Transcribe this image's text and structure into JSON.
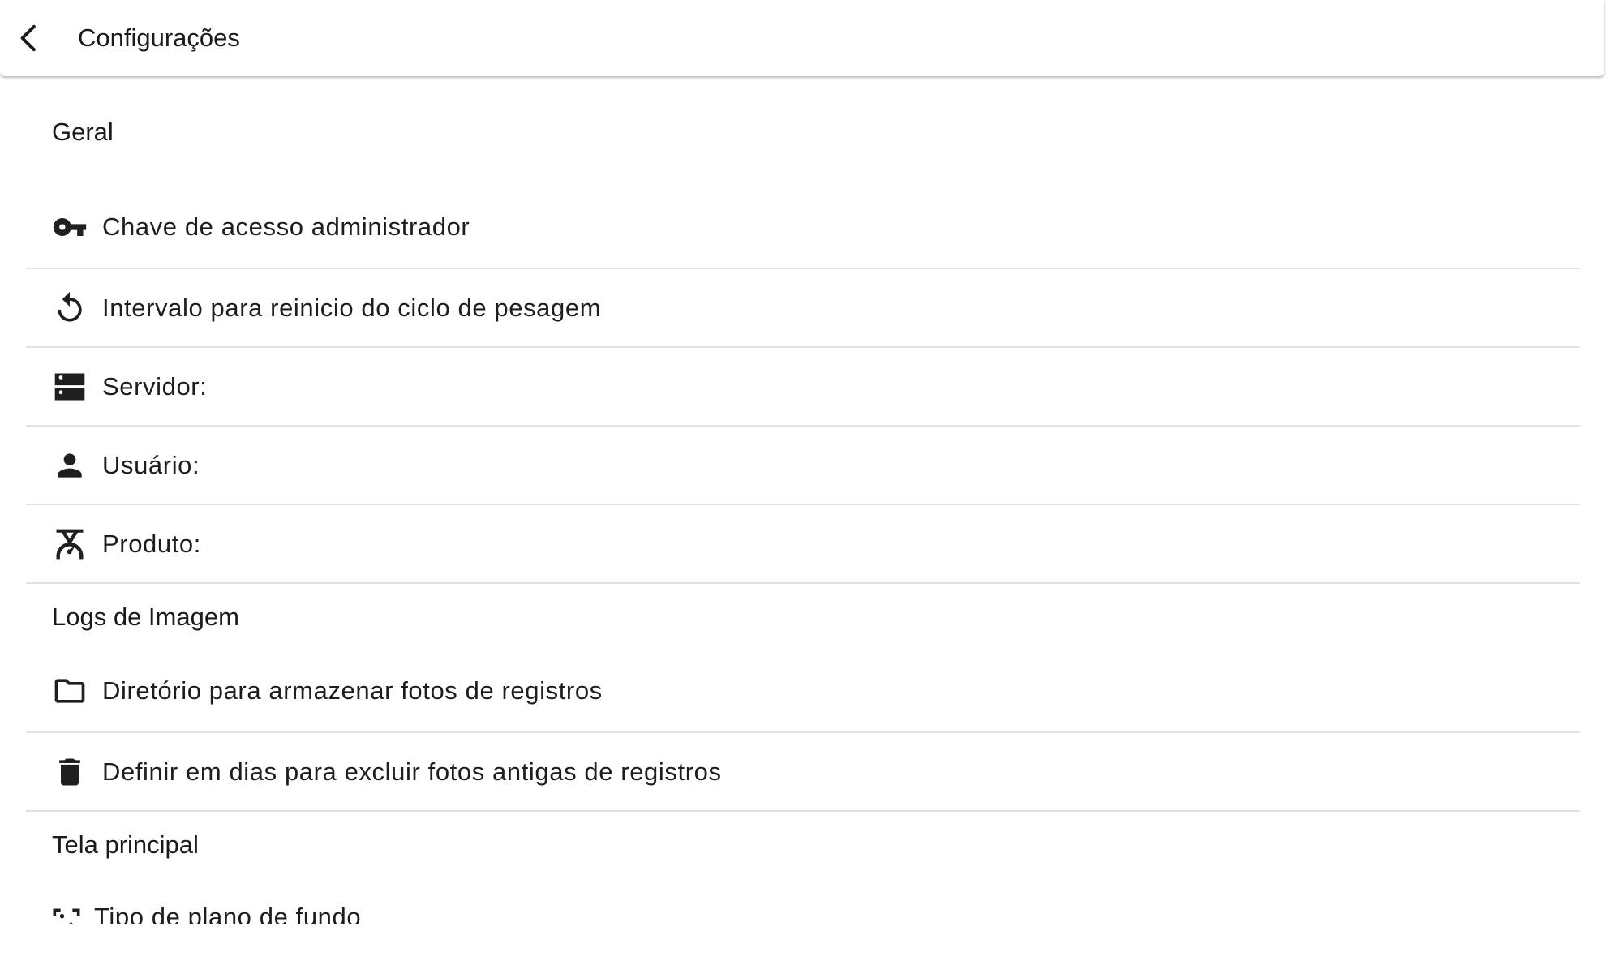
{
  "appbar": {
    "title": "Configurações",
    "back_icon": "arrow-back-icon"
  },
  "sections": [
    {
      "header": "Geral",
      "items": [
        {
          "icon": "key-icon",
          "label": "Chave de acesso administrador"
        },
        {
          "icon": "restart-icon",
          "label": "Intervalo para reinicio do ciclo de pesagem"
        },
        {
          "icon": "server-icon",
          "label": "Servidor:"
        },
        {
          "icon": "person-icon",
          "label": "Usuário:"
        },
        {
          "icon": "scale-icon",
          "label": "Produto:"
        }
      ]
    },
    {
      "header": "Logs de Imagem",
      "items": [
        {
          "icon": "folder-icon",
          "label": "Diretório para armazenar fotos de registros"
        },
        {
          "icon": "trash-icon",
          "label": "Definir em dias para excluir fotos antigas de registros"
        }
      ]
    },
    {
      "header": "Tela principal",
      "items": [
        {
          "icon": "image-frame-icon",
          "label": "Tipo de plano de fundo"
        }
      ]
    }
  ]
}
